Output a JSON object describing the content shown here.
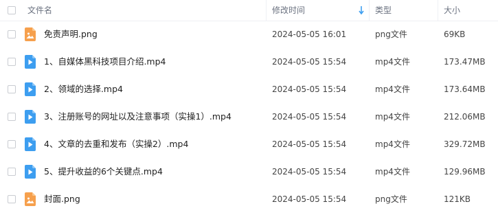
{
  "header": {
    "name": "文件名",
    "modified": "修改时间",
    "type": "类型",
    "size": "大小",
    "sort_icon": "arrow-down-icon"
  },
  "colors": {
    "image_icon": "#f6a04d",
    "video_icon": "#3d9ef0",
    "sort_arrow": "#3d9ef0"
  },
  "files": [
    {
      "name": "免责声明.png",
      "modified": "2024-05-05 16:01",
      "type": "png文件",
      "size": "69KB",
      "icon": "image-file-icon"
    },
    {
      "name": "1、自媒体黑科技项目介绍.mp4",
      "modified": "2024-05-05 15:54",
      "type": "mp4文件",
      "size": "173.47MB",
      "icon": "video-file-icon"
    },
    {
      "name": "2、领域的选择.mp4",
      "modified": "2024-05-05 15:54",
      "type": "mp4文件",
      "size": "173.64MB",
      "icon": "video-file-icon"
    },
    {
      "name": "3、注册账号的网址以及注意事项（实操1）.mp4",
      "modified": "2024-05-05 15:54",
      "type": "mp4文件",
      "size": "212.06MB",
      "icon": "video-file-icon"
    },
    {
      "name": "4、文章的去重和发布（实操2）.mp4",
      "modified": "2024-05-05 15:54",
      "type": "mp4文件",
      "size": "329.72MB",
      "icon": "video-file-icon"
    },
    {
      "name": "5、提升收益的6个关键点.mp4",
      "modified": "2024-05-05 15:54",
      "type": "mp4文件",
      "size": "129.96MB",
      "icon": "video-file-icon"
    },
    {
      "name": "封面.png",
      "modified": "2024-05-05 15:54",
      "type": "png文件",
      "size": "121KB",
      "icon": "image-file-icon"
    }
  ]
}
